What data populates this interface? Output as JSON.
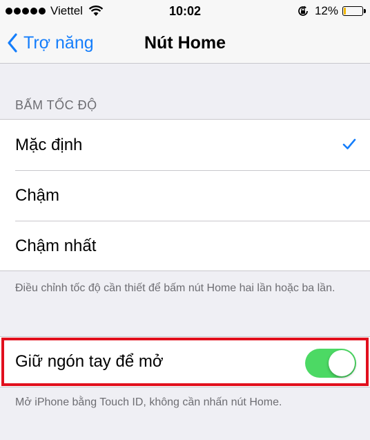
{
  "status_bar": {
    "signal_bars": 5,
    "carrier": "Viettel",
    "time": "10:02",
    "battery_percent_text": "12%",
    "battery_level": 0.12,
    "icons": [
      "signal-dots-icon",
      "wifi-icon",
      "rotation-lock-icon",
      "battery-icon"
    ]
  },
  "nav": {
    "back_label": "Trợ năng",
    "title": "Nút Home"
  },
  "click_speed": {
    "header": "BẤM TỐC ĐỘ",
    "options": [
      {
        "label": "Mặc định",
        "selected": true
      },
      {
        "label": "Chậm",
        "selected": false
      },
      {
        "label": "Chậm nhất",
        "selected": false
      }
    ],
    "footer": "Điều chỉnh tốc độ cần thiết để bấm nút Home hai lần hoặc ba lần."
  },
  "rest_finger": {
    "label": "Giữ ngón tay để mở",
    "enabled": true,
    "footer": "Mở iPhone bằng Touch ID, không cần nhấn nút Home."
  },
  "colors": {
    "accent": "#157efb",
    "switch_on": "#4cd964",
    "highlight_border": "#e1101d",
    "battery_low": "#f2b800",
    "background": "#efeff4"
  }
}
